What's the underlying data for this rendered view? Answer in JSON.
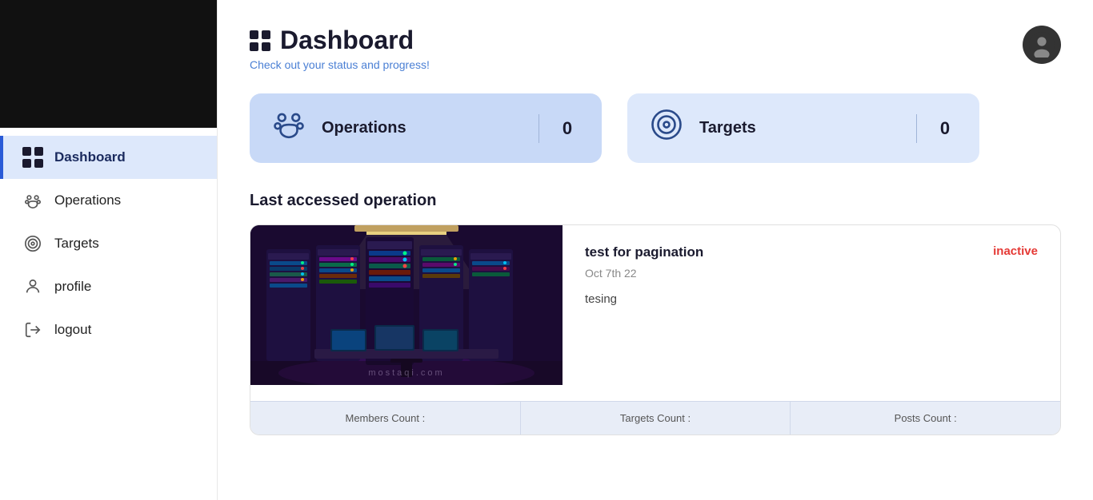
{
  "sidebar": {
    "logo_alt": "Logo",
    "nav_items": [
      {
        "id": "dashboard",
        "label": "Dashboard",
        "icon": "grid",
        "active": true
      },
      {
        "id": "operations",
        "label": "Operations",
        "icon": "paw",
        "active": false
      },
      {
        "id": "targets",
        "label": "Targets",
        "icon": "target",
        "active": false
      },
      {
        "id": "profile",
        "label": "profile",
        "icon": "person",
        "active": false
      },
      {
        "id": "logout",
        "label": "logout",
        "icon": "logout",
        "active": false
      }
    ]
  },
  "header": {
    "title": "Dashboard",
    "subtitle": "Check out your status and progress!",
    "avatar_alt": "User avatar"
  },
  "stats": [
    {
      "id": "operations",
      "label": "Operations",
      "count": "0",
      "icon": "🐾"
    },
    {
      "id": "targets",
      "label": "Targets",
      "count": "0",
      "icon": "🎯"
    }
  ],
  "last_operation": {
    "section_title": "Last accessed operation",
    "card": {
      "title": "test for pagination",
      "status": "inactive",
      "date": "Oct 7th 22",
      "description": "tesing",
      "footer": {
        "members_label": "Members Count :",
        "targets_label": "Targets Count :",
        "posts_label": "Posts Count :"
      }
    }
  },
  "watermark": "mostaqi.com"
}
